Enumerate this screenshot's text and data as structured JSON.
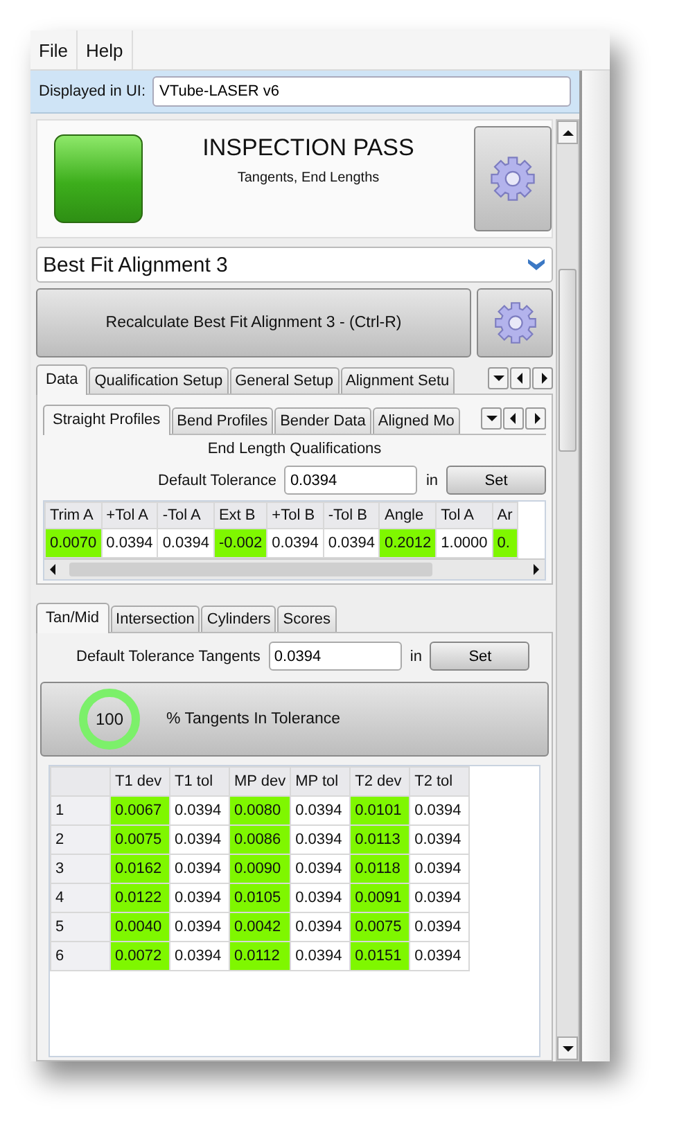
{
  "menu": [
    {
      "label": "File"
    },
    {
      "label": "Help"
    }
  ],
  "display": {
    "label": "Displayed in UI:",
    "value": "VTube-LASER v6"
  },
  "status": {
    "passed": true,
    "title": "INSPECTION PASS",
    "subtitle": "Tangents, End Lengths"
  },
  "alignment": {
    "value": "Best Fit Alignment 3"
  },
  "recalculate": {
    "label": "Recalculate Best Fit Alignment 3 - (Ctrl-R)"
  },
  "tabs": [
    {
      "label": "Data",
      "selected": true
    },
    {
      "label": "Qualification Setup",
      "selected": false
    },
    {
      "label": "General Setup",
      "selected": false
    },
    {
      "label": "Alignment Setu",
      "selected": false
    }
  ],
  "sub_tabs": [
    {
      "label": "Straight Profiles",
      "selected": true
    },
    {
      "label": "Bend Profiles",
      "selected": false
    },
    {
      "label": "Bender Data",
      "selected": false
    },
    {
      "label": "Aligned Mo",
      "selected": false
    }
  ],
  "end_length": {
    "title": "End Length Qualifications",
    "tolerance_label": "Default Tolerance",
    "tolerance": "0.0394",
    "unit": "in",
    "button": "Set",
    "columns": [
      "Trim A",
      "+Tol A",
      "-Tol A",
      "Ext B",
      "+Tol B",
      "-Tol B",
      "Angle",
      "Tol A",
      "Ar"
    ],
    "rows": [
      [
        {
          "text": "0.0070",
          "pass": true
        },
        {
          "text": "0.0394",
          "pass": false
        },
        {
          "text": "0.0394",
          "pass": false
        },
        {
          "text": "-0.002",
          "pass": true
        },
        {
          "text": "0.0394",
          "pass": false
        },
        {
          "text": "0.0394",
          "pass": false
        },
        {
          "text": "0.2012",
          "pass": true
        },
        {
          "text": "1.0000",
          "pass": false
        },
        {
          "text": "0.",
          "pass": true
        }
      ]
    ]
  },
  "tangent_tabs": [
    {
      "label": "Tan/Mid",
      "selected": true
    },
    {
      "label": "Intersection",
      "selected": false
    },
    {
      "label": "Cylinders",
      "selected": false
    },
    {
      "label": "Scores",
      "selected": false
    }
  ],
  "tangents": {
    "tolerance_label": "Default Tolerance Tangents",
    "tolerance": "0.0394",
    "unit": "in",
    "button": "Set",
    "percent": "100",
    "level": 1,
    "summary": "% Tangents In Tolerance",
    "columns": [
      "T1 dev",
      "T1 tol",
      "MP dev",
      "MP tol",
      "T2 dev",
      "T2 tol"
    ],
    "rows": [
      {
        "index": "1",
        "cells": [
          {
            "text": "0.0067",
            "pass": true
          },
          {
            "text": "0.0394",
            "pass": false
          },
          {
            "text": "0.0080",
            "pass": true
          },
          {
            "text": "0.0394",
            "pass": false
          },
          {
            "text": "0.0101",
            "pass": true
          },
          {
            "text": "0.0394",
            "pass": false
          }
        ]
      },
      {
        "index": "2",
        "cells": [
          {
            "text": "0.0075",
            "pass": true
          },
          {
            "text": "0.0394",
            "pass": false
          },
          {
            "text": "0.0086",
            "pass": true
          },
          {
            "text": "0.0394",
            "pass": false
          },
          {
            "text": "0.0113",
            "pass": true
          },
          {
            "text": "0.0394",
            "pass": false
          }
        ]
      },
      {
        "index": "3",
        "cells": [
          {
            "text": "0.0162",
            "pass": true
          },
          {
            "text": "0.0394",
            "pass": false
          },
          {
            "text": "0.0090",
            "pass": true
          },
          {
            "text": "0.0394",
            "pass": false
          },
          {
            "text": "0.0118",
            "pass": true
          },
          {
            "text": "0.0394",
            "pass": false
          }
        ]
      },
      {
        "index": "4",
        "cells": [
          {
            "text": "0.0122",
            "pass": true
          },
          {
            "text": "0.0394",
            "pass": false
          },
          {
            "text": "0.0105",
            "pass": true
          },
          {
            "text": "0.0394",
            "pass": false
          },
          {
            "text": "0.0091",
            "pass": true
          },
          {
            "text": "0.0394",
            "pass": false
          }
        ]
      },
      {
        "index": "5",
        "cells": [
          {
            "text": "0.0040",
            "pass": true
          },
          {
            "text": "0.0394",
            "pass": false
          },
          {
            "text": "0.0042",
            "pass": true
          },
          {
            "text": "0.0394",
            "pass": false
          },
          {
            "text": "0.0075",
            "pass": true
          },
          {
            "text": "0.0394",
            "pass": false
          }
        ]
      },
      {
        "index": "6",
        "cells": [
          {
            "text": "0.0072",
            "pass": true
          },
          {
            "text": "0.0394",
            "pass": false
          },
          {
            "text": "0.0112",
            "pass": true
          },
          {
            "text": "0.0394",
            "pass": false
          },
          {
            "text": "0.0151",
            "pass": true
          },
          {
            "text": "0.0394",
            "pass": false
          }
        ]
      }
    ]
  }
}
